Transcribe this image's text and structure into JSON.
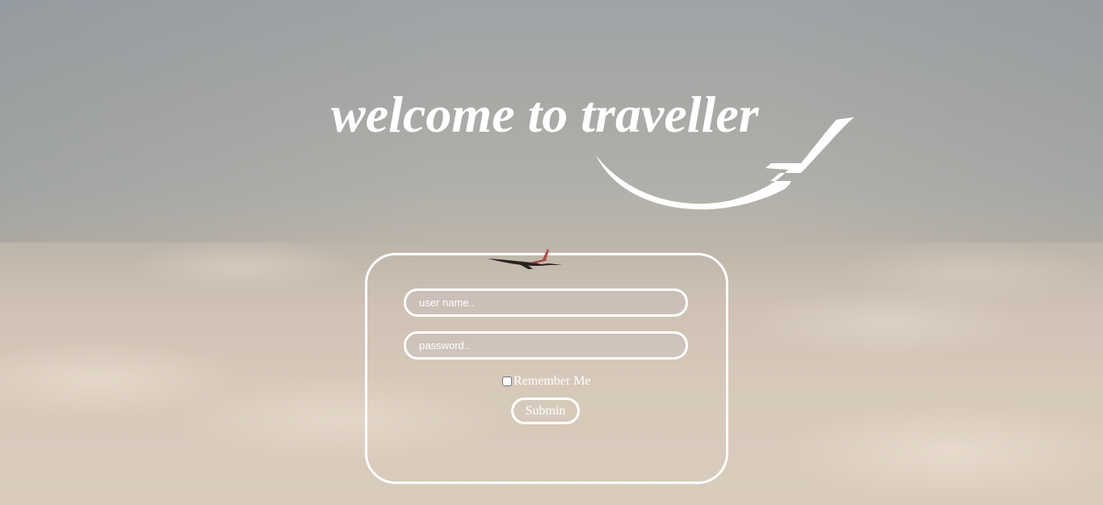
{
  "header": {
    "title": "welcome to traveller",
    "logo_icon": "plane-swoosh-icon"
  },
  "login": {
    "username_placeholder": "user name..",
    "username_value": "",
    "password_placeholder": "password..",
    "password_value": "",
    "remember_label": "Remember Me",
    "remember_checked": false,
    "submit_label": "Submin"
  },
  "colors": {
    "text": "#ffffff",
    "border": "#ffffff"
  }
}
